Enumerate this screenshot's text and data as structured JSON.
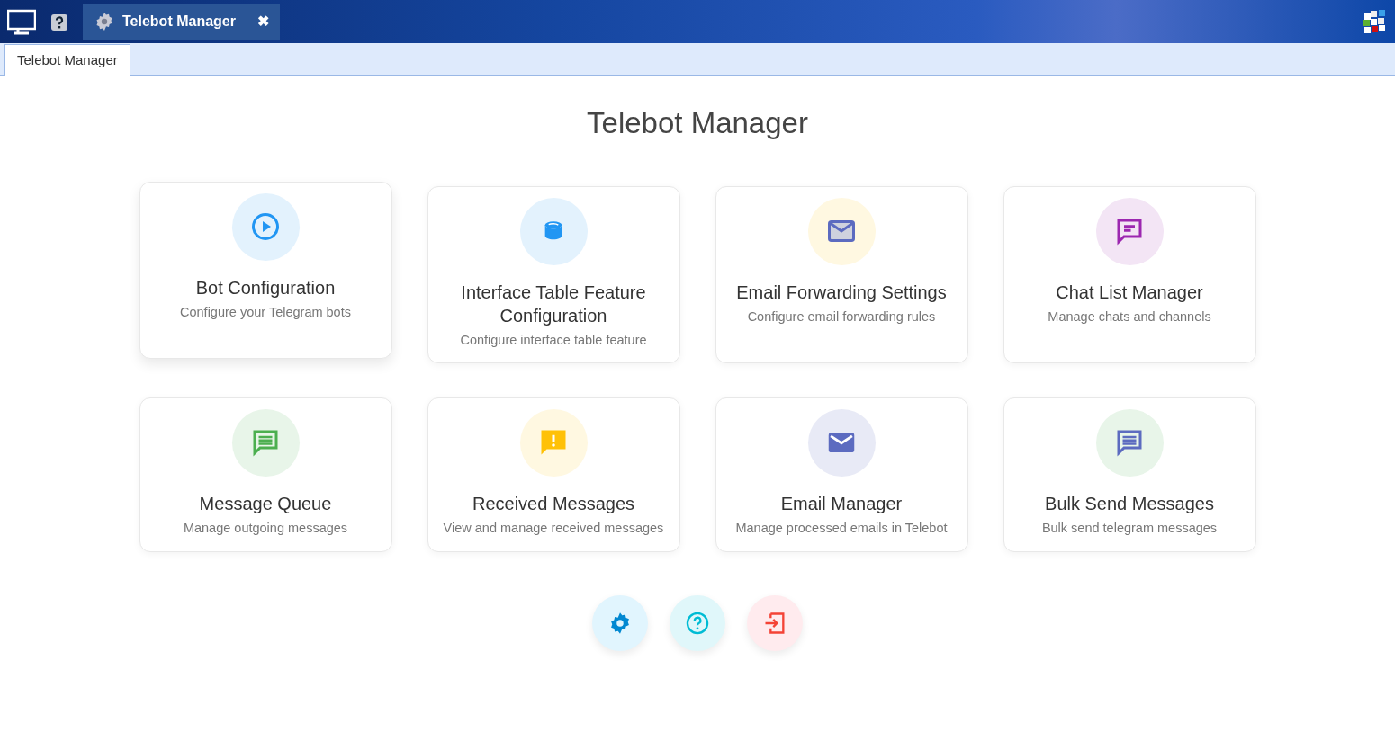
{
  "taskbar": {
    "app_tab": {
      "title": "Telebot Manager",
      "selected": true
    },
    "close_glyph": "✖"
  },
  "tabs": [
    {
      "label": "Telebot Manager",
      "selected": true
    }
  ],
  "heading": "Telebot Manager",
  "cards": [
    {
      "kind": "play",
      "title": "Bot Configuration",
      "subtitle": "Configure your Telegram bots",
      "color": "#2196f3",
      "raised": true
    },
    {
      "kind": "database",
      "title": "Interface Table Feature Configuration",
      "subtitle": "Configure interface table feature",
      "color": "#2196f3",
      "raised": false
    },
    {
      "kind": "forward",
      "title": "Email Forwarding Settings",
      "subtitle": "Configure email forwarding rules",
      "color": "#5c6bc0",
      "raised": false
    },
    {
      "kind": "chat",
      "title": "Chat List Manager",
      "subtitle": "Manage chats and channels",
      "color": "#9c27b0",
      "raised": false
    },
    {
      "kind": "message",
      "title": "Message Queue",
      "subtitle": "Manage outgoing messages",
      "color": "#4caf50",
      "raised": false
    },
    {
      "kind": "alert",
      "title": "Received Messages",
      "subtitle": "View and manage received messages",
      "color": "#ffc107",
      "raised": false
    },
    {
      "kind": "mail",
      "title": "Email Manager",
      "subtitle": "Manage processed emails in Telebot",
      "color": "#5c6bc0",
      "raised": false
    },
    {
      "kind": "message",
      "title": "Bulk Send Messages",
      "subtitle": "Bulk send telegram messages",
      "color": "#5c6bc0",
      "raised": false
    }
  ],
  "actions": [
    {
      "kind": "settings",
      "color": "#0288d1"
    },
    {
      "kind": "help",
      "color": "#00bcd4"
    },
    {
      "kind": "logout",
      "color": "#f44336"
    }
  ]
}
